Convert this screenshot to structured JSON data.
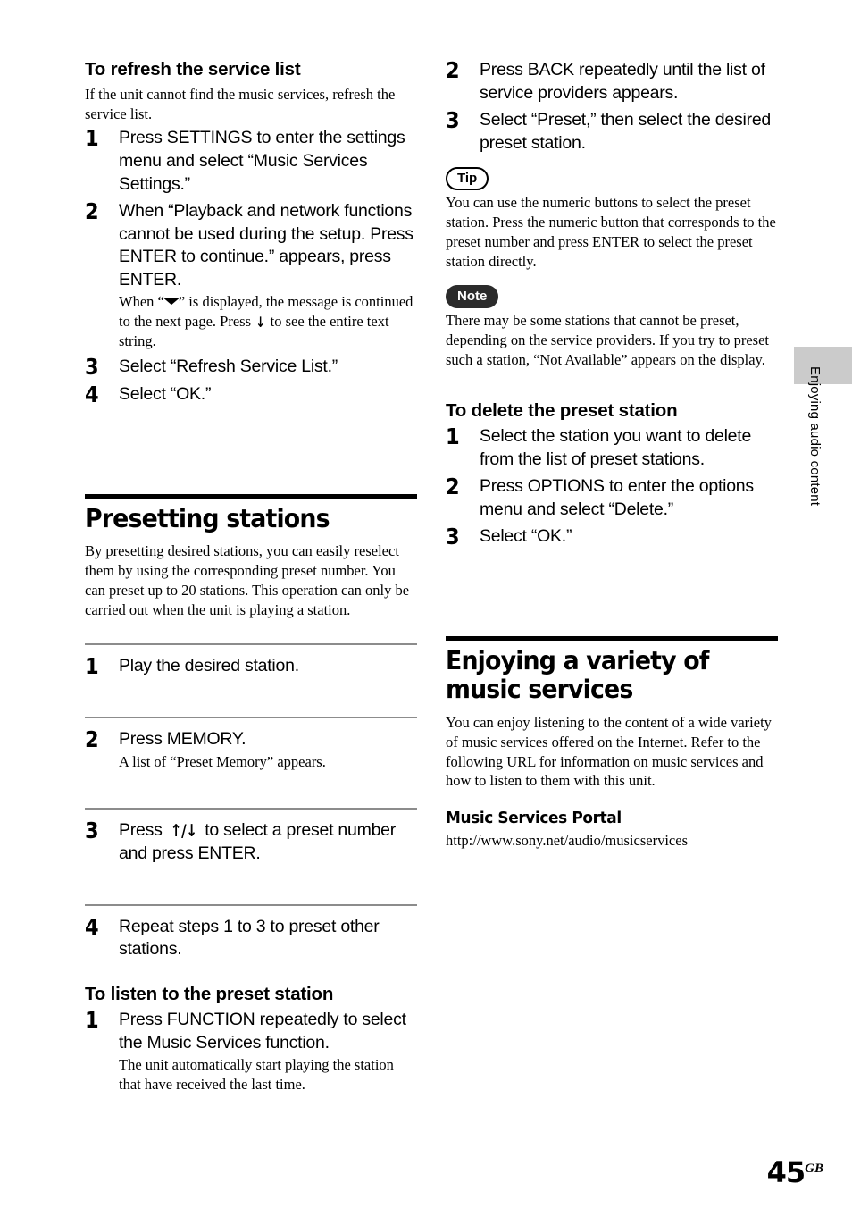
{
  "document": {
    "page_number": "45",
    "page_suffix": "GB",
    "side_tab_label": "Enjoying audio content"
  },
  "left_column": {
    "refresh_section": {
      "heading": "To refresh the service list",
      "intro": "If the unit cannot find the music services, refresh the service list.",
      "steps": [
        {
          "num": "1",
          "text": "Press SETTINGS to enter the settings menu and select “Music Services Settings.”"
        },
        {
          "num": "2",
          "text": "When “Playback and network functions cannot be used during the setup. Press ENTER to continue.” appears, press ENTER.",
          "note_before": "When “",
          "note_after": "” is displayed, the message is continued to the next page. Press",
          "note_end": "to see the entire text string."
        },
        {
          "num": "3",
          "text": "Select “Refresh Service List.”"
        },
        {
          "num": "4",
          "text": "Select “OK.”"
        }
      ]
    },
    "presetting_section": {
      "heading": "Presetting stations",
      "intro": "By presetting desired stations, you can easily reselect them by using the corresponding preset number. You can preset up to 20 stations. This operation can only be carried out when the unit is playing a station.",
      "steps": [
        {
          "num": "1",
          "text": "Play the desired station."
        },
        {
          "num": "2",
          "text": "Press MEMORY.",
          "note": "A list of “Preset Memory” appears."
        },
        {
          "num": "3",
          "text_before": "Press",
          "text_after": "to select a preset number and press ENTER."
        },
        {
          "num": "4",
          "text": "Repeat steps 1 to 3 to preset other stations."
        }
      ]
    },
    "listen_section": {
      "heading": "To listen to the preset station",
      "steps": [
        {
          "num": "1",
          "text": "Press FUNCTION repeatedly to select the Music Services function.",
          "note": "The unit automatically start playing the station that have received the last time."
        }
      ]
    }
  },
  "right_column": {
    "continued_steps": [
      {
        "num": "2",
        "text": "Press BACK repeatedly until the list of service providers appears."
      },
      {
        "num": "3",
        "text": "Select “Preset,” then select the desired preset station."
      }
    ],
    "tip": {
      "label": "Tip",
      "text": "You can use the numeric buttons to select the preset station. Press the numeric button that corresponds to the preset number and press ENTER to select the preset station directly."
    },
    "note": {
      "label": "Note",
      "text": "There may be some stations that cannot be preset, depending on the service providers. If you try to preset such a station, “Not Available” appears on the display."
    },
    "delete_section": {
      "heading": "To delete the preset station",
      "steps": [
        {
          "num": "1",
          "text": "Select the station you want to delete from the list of preset stations."
        },
        {
          "num": "2",
          "text": "Press OPTIONS to enter the options menu and select “Delete.”"
        },
        {
          "num": "3",
          "text": "Select “OK.”"
        }
      ]
    },
    "enjoying_section": {
      "heading": "Enjoying a variety of music services",
      "intro": "You can enjoy listening to the content of a wide variety of music services offered on the Internet. Refer to the following URL for information on music services and how to listen to them with this unit.",
      "portal_heading": "Music Services Portal",
      "portal_url": "http://www.sony.net/audio/musicservices"
    }
  },
  "glyphs": {
    "wide_down_arrow": "▼",
    "down_arrow": "↓",
    "up_down_arrows": "↑/↓"
  }
}
